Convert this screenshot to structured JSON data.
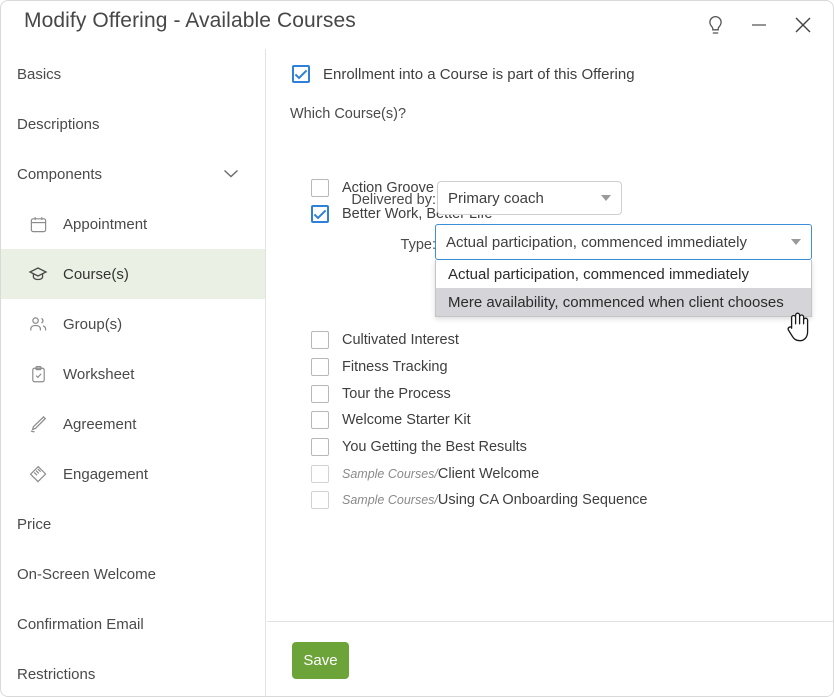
{
  "window": {
    "title": "Modify Offering - Available Courses",
    "controls": [
      {
        "name": "help-lightbulb-icon",
        "label": "Help"
      },
      {
        "name": "minimize-button",
        "label": "Minimize"
      },
      {
        "name": "close-button",
        "label": "Close"
      }
    ]
  },
  "sidebar": {
    "items": [
      {
        "label": "Basics",
        "icon": null,
        "type": "top",
        "active": false
      },
      {
        "label": "Descriptions",
        "icon": null,
        "type": "top",
        "active": false
      },
      {
        "label": "Components",
        "icon": null,
        "type": "top",
        "active": false,
        "expanded": true
      },
      {
        "label": "Appointment",
        "icon": "calendar-icon",
        "type": "sub",
        "active": false
      },
      {
        "label": "Course(s)",
        "icon": "graduation-cap-icon",
        "type": "sub",
        "active": true
      },
      {
        "label": "Group(s)",
        "icon": "people-icon",
        "type": "sub",
        "active": false
      },
      {
        "label": "Worksheet",
        "icon": "clipboard-check-icon",
        "type": "sub",
        "active": false
      },
      {
        "label": "Agreement",
        "icon": "pen-signature-icon",
        "type": "sub",
        "active": false
      },
      {
        "label": "Engagement",
        "icon": "handshake-icon",
        "type": "sub",
        "active": false
      },
      {
        "label": "Price",
        "icon": null,
        "type": "top",
        "active": false
      },
      {
        "label": "On-Screen Welcome",
        "icon": null,
        "type": "top",
        "active": false
      },
      {
        "label": "Confirmation Email",
        "icon": null,
        "type": "top",
        "active": false
      },
      {
        "label": "Restrictions",
        "icon": null,
        "type": "top",
        "active": false
      }
    ]
  },
  "main": {
    "enrollment_checkbox": {
      "label": "Enrollment into a Course is part of this Offering",
      "checked": true
    },
    "which_courses_label": "Which Course(s)?",
    "courses": [
      {
        "prefix": "",
        "name": "Action Groove",
        "checked": false,
        "faded": false
      },
      {
        "prefix": "",
        "name": "Better Work, Better Life",
        "checked": true,
        "faded": false
      },
      {
        "prefix": "",
        "name": "Cultivated Interest",
        "checked": false,
        "faded": false
      },
      {
        "prefix": "",
        "name": "Fitness Tracking",
        "checked": false,
        "faded": false
      },
      {
        "prefix": "",
        "name": "Tour the Process",
        "checked": false,
        "faded": false
      },
      {
        "prefix": "",
        "name": "Welcome Starter Kit",
        "checked": false,
        "faded": false
      },
      {
        "prefix": "",
        "name": "You Getting the Best Results",
        "checked": false,
        "faded": false
      },
      {
        "prefix": "Sample Courses/",
        "name": "Client Welcome",
        "checked": false,
        "faded": true
      },
      {
        "prefix": "Sample Courses/",
        "name": "Using CA Onboarding Sequence",
        "checked": false,
        "faded": true
      }
    ],
    "delivered_by": {
      "label": "Delivered by:",
      "value": "Primary coach"
    },
    "type": {
      "label": "Type:",
      "value": "Actual participation, commenced immediately",
      "open": true,
      "options": [
        {
          "label": "Actual participation, commenced immediately",
          "hover": false
        },
        {
          "label": "Mere availability, commenced when client chooses",
          "hover": true
        }
      ]
    }
  },
  "footer": {
    "save_label": "Save"
  },
  "colors": {
    "accent_green": "#6da43a",
    "active_nav_bg": "#eaf1e4",
    "checkbox_blue": "#2f80d8",
    "focus_blue": "#3a8fd8",
    "option_hover": "#d4d4d9"
  }
}
